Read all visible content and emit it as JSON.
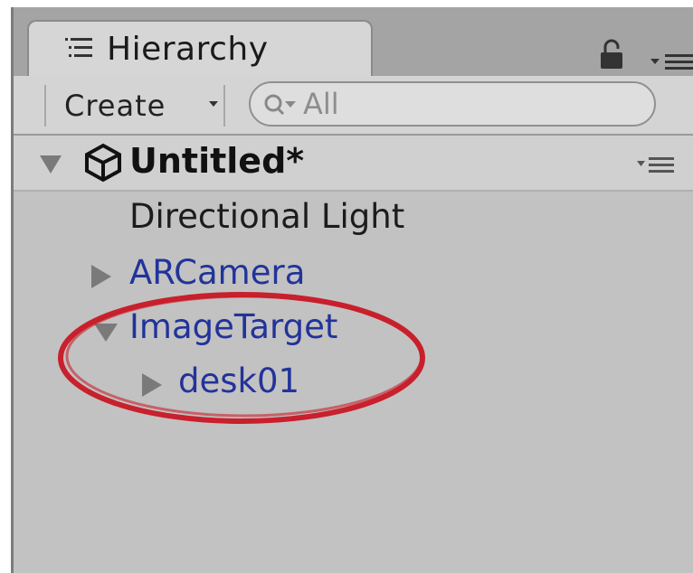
{
  "window": {
    "tab_label": "Hierarchy",
    "icons": [
      "hierarchy-list-icon",
      "lock-icon",
      "menu-icon"
    ]
  },
  "toolbar": {
    "create_label": "Create",
    "search_placeholder": "All"
  },
  "scene": {
    "name": "Untitled*",
    "expanded": true
  },
  "tree": [
    {
      "label": "Directional Light",
      "has_children": false,
      "expanded": false,
      "depth": 0
    },
    {
      "label": "ARCamera",
      "has_children": true,
      "expanded": false,
      "depth": 0
    },
    {
      "label": "ImageTarget",
      "has_children": true,
      "expanded": true,
      "depth": 0
    },
    {
      "label": "desk01",
      "has_children": true,
      "expanded": false,
      "depth": 1
    }
  ],
  "colors": {
    "panel_bg": "#c2c2c2",
    "prefab_text": "#22339a",
    "annotation": "#c8202c"
  }
}
